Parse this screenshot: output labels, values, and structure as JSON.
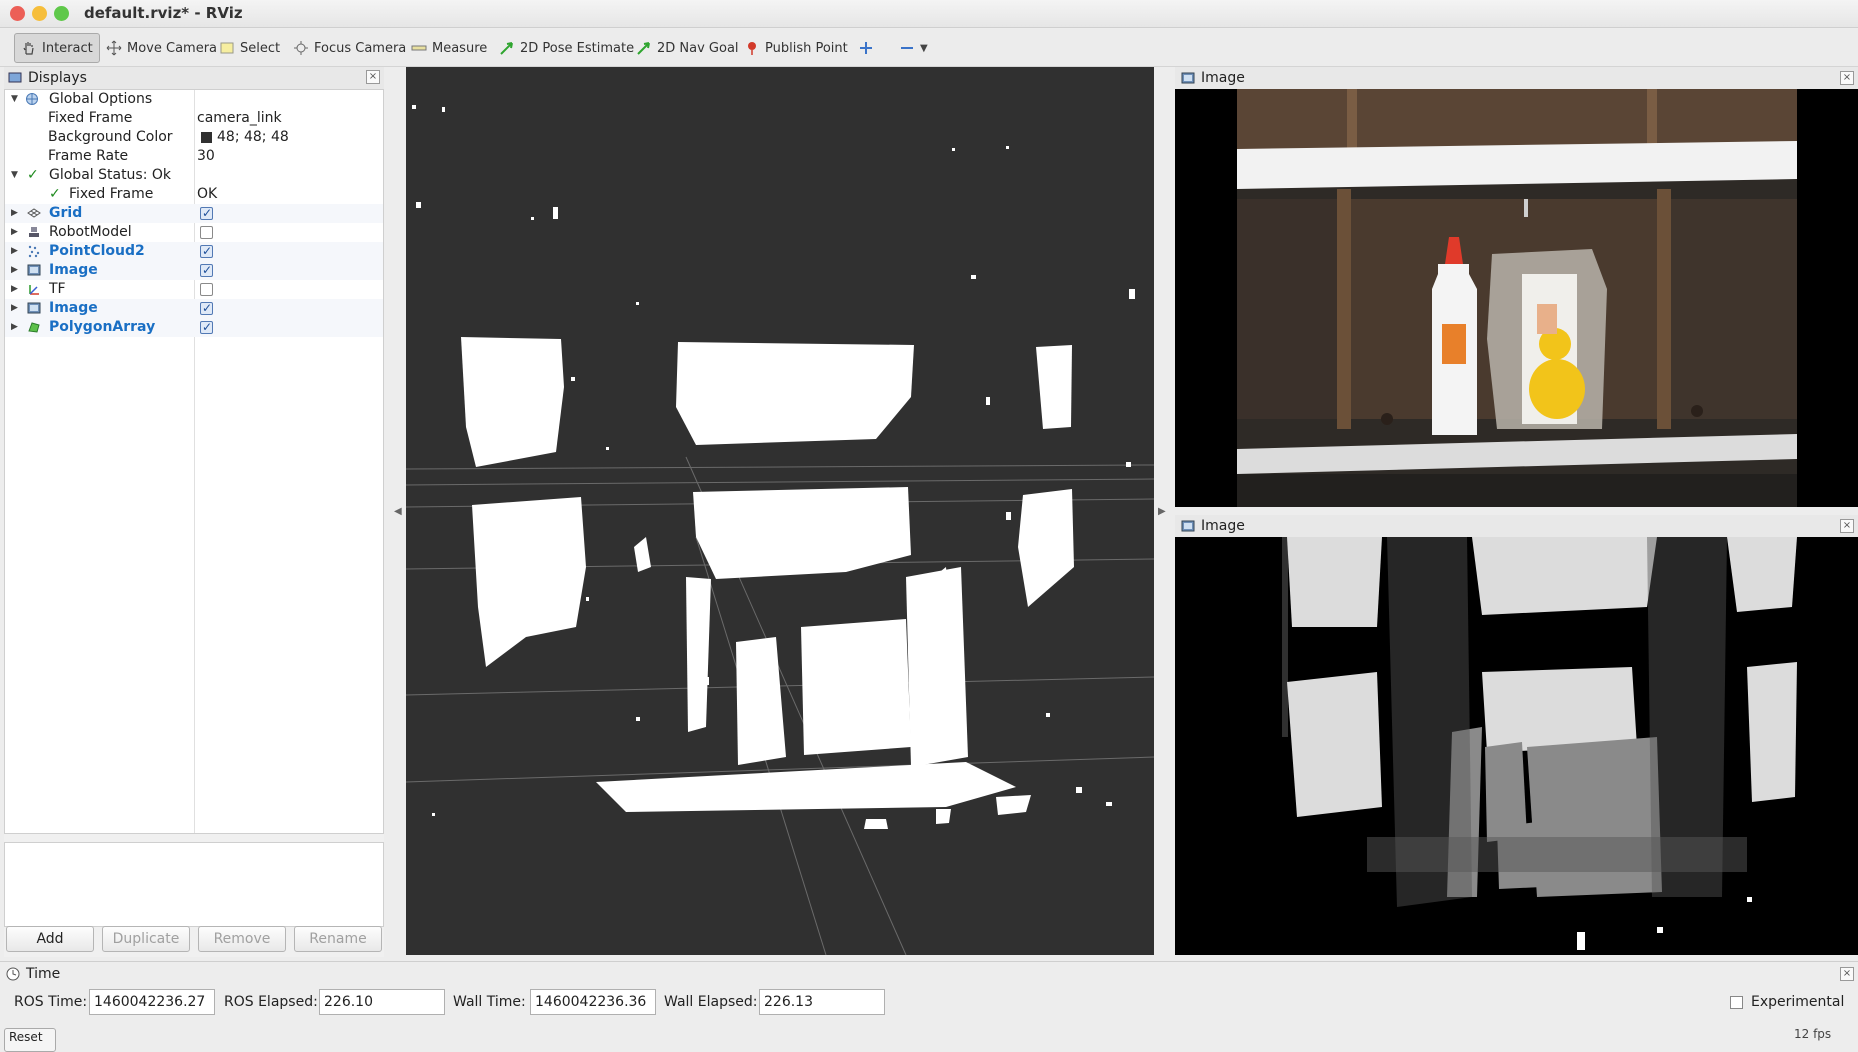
{
  "window": {
    "title": "default.rviz* - RViz"
  },
  "toolbar": {
    "tools": [
      {
        "label": "Interact",
        "icon": "hand-icon",
        "active": true
      },
      {
        "label": "Move Camera",
        "icon": "move-camera-icon"
      },
      {
        "label": "Select",
        "icon": "select-box-icon"
      },
      {
        "label": "Focus Camera",
        "icon": "focus-icon"
      },
      {
        "label": "Measure",
        "icon": "ruler-icon"
      },
      {
        "label": "2D Pose Estimate",
        "icon": "green-arrow-icon"
      },
      {
        "label": "2D Nav Goal",
        "icon": "green-arrow-icon"
      },
      {
        "label": "Publish Point",
        "icon": "pin-icon"
      }
    ],
    "add_tool_icon": "plus-icon",
    "remove_tool_icon": "minus-icon"
  },
  "displays": {
    "title": "Displays",
    "global_options": {
      "label": "Global Options",
      "fixed_frame_label": "Fixed Frame",
      "fixed_frame_value": "camera_link",
      "bg_color_label": "Background Color",
      "bg_color_value": "48; 48; 48",
      "bg_color_swatch": "#303030",
      "frame_rate_label": "Frame Rate",
      "frame_rate_value": "30"
    },
    "global_status": {
      "label": "Global Status: Ok",
      "child_label": "Fixed Frame",
      "child_value": "OK"
    },
    "items": [
      {
        "label": "Grid",
        "checked": true,
        "highlight": true,
        "icon": "grid-icon"
      },
      {
        "label": "RobotModel",
        "checked": false,
        "highlight": false,
        "icon": "robot-icon"
      },
      {
        "label": "PointCloud2",
        "checked": true,
        "highlight": true,
        "icon": "pointcloud-icon"
      },
      {
        "label": "Image",
        "checked": true,
        "highlight": true,
        "icon": "image-icon"
      },
      {
        "label": "TF",
        "checked": false,
        "highlight": false,
        "icon": "tf-axes-icon"
      },
      {
        "label": "Image",
        "checked": true,
        "highlight": true,
        "icon": "image-icon"
      },
      {
        "label": "PolygonArray",
        "checked": true,
        "highlight": true,
        "icon": "polygon-icon"
      }
    ],
    "buttons": {
      "add": "Add",
      "duplicate": "Duplicate",
      "remove": "Remove",
      "rename": "Rename"
    }
  },
  "image_panels": {
    "top_title": "Image",
    "bottom_title": "Image"
  },
  "time": {
    "title": "Time",
    "ros_time_label": "ROS Time:",
    "ros_time_value": "1460042236.27",
    "ros_elapsed_label": "ROS Elapsed:",
    "ros_elapsed_value": "226.10",
    "wall_time_label": "Wall Time:",
    "wall_time_value": "1460042236.36",
    "wall_elapsed_label": "Wall Elapsed:",
    "wall_elapsed_value": "226.13",
    "experimental_label": "Experimental",
    "fps": "12 fps",
    "reset_label": "Reset"
  }
}
